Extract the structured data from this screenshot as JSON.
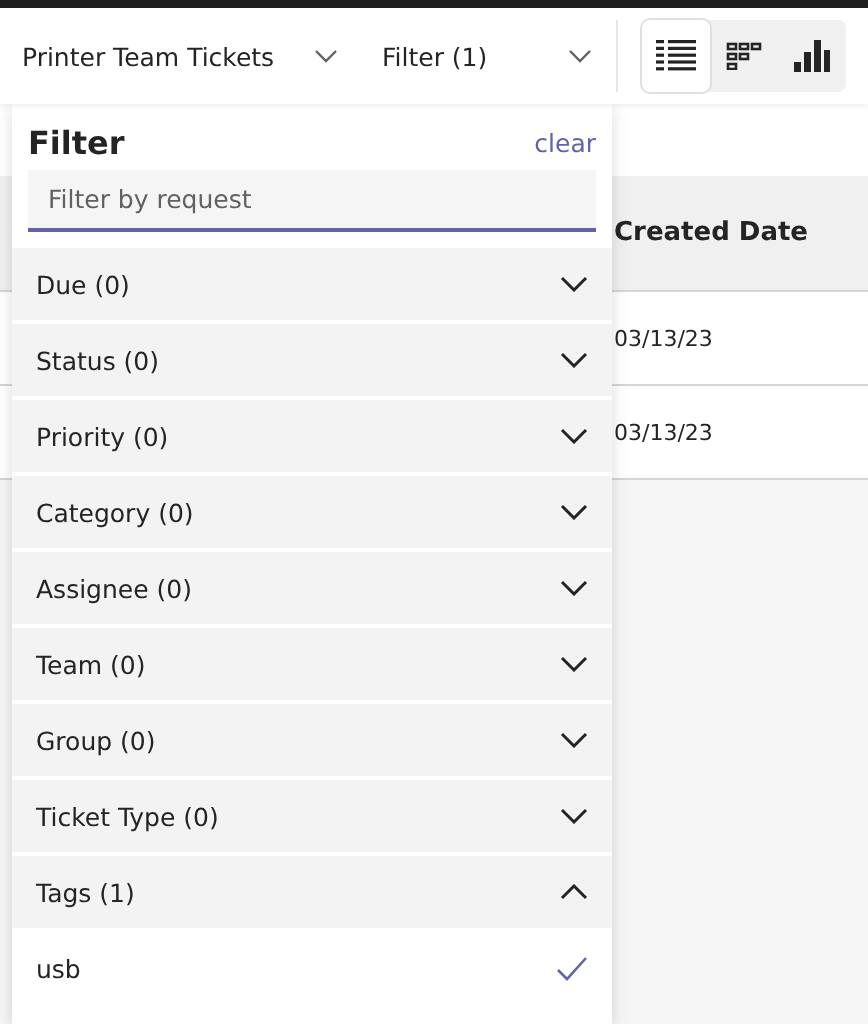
{
  "toolbar": {
    "team_selector": "Printer Team Tickets",
    "filter_button": "Filter (1)"
  },
  "view_toggle": [
    {
      "kind": "list",
      "selected": true
    },
    {
      "kind": "board",
      "selected": false
    },
    {
      "kind": "chart",
      "selected": false
    }
  ],
  "table": {
    "columns": [
      "Created Date"
    ],
    "rows": [
      [
        "03/13/23"
      ],
      [
        "03/13/23"
      ]
    ]
  },
  "filter_panel": {
    "title": "Filter",
    "clear": "clear",
    "search": {
      "placeholder": "Filter by request"
    },
    "sections": [
      {
        "label": "Due (0)",
        "expanded": false
      },
      {
        "label": "Status (0)",
        "expanded": false
      },
      {
        "label": "Priority (0)",
        "expanded": false
      },
      {
        "label": "Category (0)",
        "expanded": false
      },
      {
        "label": "Assignee (0)",
        "expanded": false
      },
      {
        "label": "Team (0)",
        "expanded": false
      },
      {
        "label": "Group (0)",
        "expanded": false
      },
      {
        "label": "Ticket Type (0)",
        "expanded": false
      },
      {
        "label": "Tags (1)",
        "expanded": true,
        "options": [
          {
            "label": "usb",
            "checked": true
          }
        ]
      }
    ]
  }
}
